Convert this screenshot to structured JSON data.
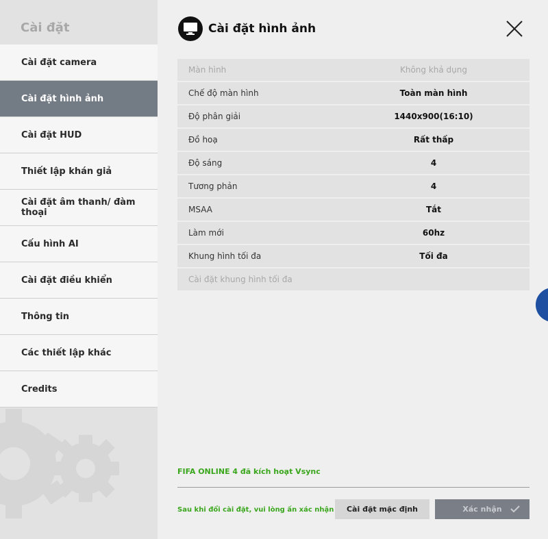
{
  "sidebar": {
    "title": "Cài đặt",
    "items": [
      {
        "label": "Cài đặt camera",
        "active": false
      },
      {
        "label": "Cài đặt hình ảnh",
        "active": true
      },
      {
        "label": "Cài đặt HUD",
        "active": false
      },
      {
        "label": "Thiết lập khán giả",
        "active": false
      },
      {
        "label": "Cài đặt âm thanh/ đàm thoại",
        "active": false
      },
      {
        "label": "Cấu hình AI",
        "active": false
      },
      {
        "label": "Cài đặt điều khiển",
        "active": false
      },
      {
        "label": "Thông tin",
        "active": false
      },
      {
        "label": "Các thiết lập khác",
        "active": false
      },
      {
        "label": "Credits",
        "active": false
      }
    ]
  },
  "main": {
    "title": "Cài đặt hình ảnh",
    "settings": [
      {
        "label": "Màn hình",
        "value": "Không khả dụng",
        "disabled": true
      },
      {
        "label": "Chế độ màn hình",
        "value": "Toàn màn hình",
        "disabled": false
      },
      {
        "label": "Độ phân giải",
        "value": "1440x900(16:10)",
        "disabled": false
      },
      {
        "label": "Đồ hoạ",
        "value": "Rất thấp",
        "disabled": false
      },
      {
        "label": "Độ sáng",
        "value": "4",
        "disabled": false
      },
      {
        "label": "Tương phản",
        "value": "4",
        "disabled": false
      },
      {
        "label": "MSAA",
        "value": "Tắt",
        "disabled": false
      },
      {
        "label": "Làm mới",
        "value": "60hz",
        "disabled": false
      },
      {
        "label": "Khung hình tối đa",
        "value": "Tối đa",
        "disabled": false
      },
      {
        "label": "Cài đặt khung hình tối đa",
        "value": "",
        "disabled": true
      }
    ],
    "vsync_note": "FIFA ONLINE 4 đã kích hoạt Vsync",
    "confirm_hint": "Sau khi đổi cài đặt, vui lòng ấn xác nhận",
    "default_button": "Cài đặt mặc định",
    "confirm_button": "Xác nhận"
  },
  "colors": {
    "accent_green": "#3aa61c",
    "active_item": "#737b85"
  },
  "icons": {
    "header": "monitor-icon",
    "close": "close-icon",
    "confirm": "check-icon"
  }
}
